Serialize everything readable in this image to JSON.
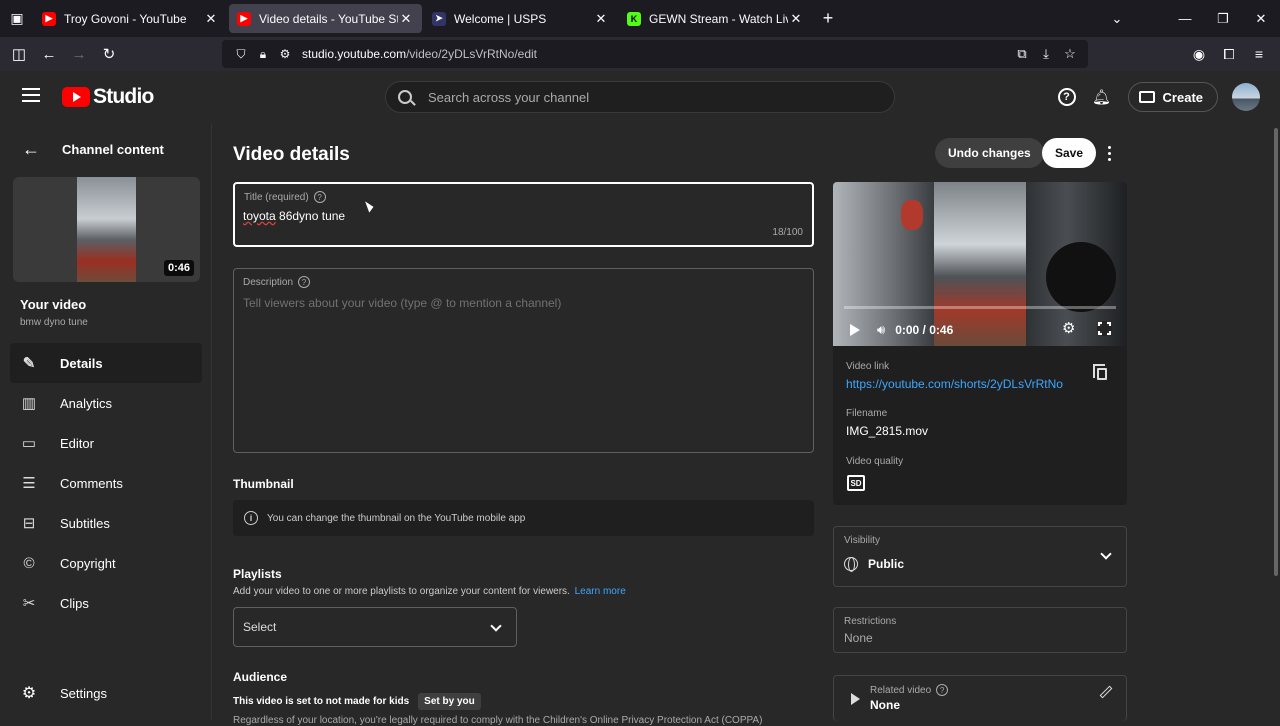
{
  "browser": {
    "tabs": [
      {
        "title": "Troy Govoni - YouTube",
        "favicon_color": "#ff0000",
        "favicon_glyph": "▶",
        "active": false
      },
      {
        "title": "Video details - YouTube Studio",
        "favicon_color": "#ff0000",
        "favicon_glyph": "▶",
        "active": true
      },
      {
        "title": "Welcome | USPS",
        "favicon_color": "#333366",
        "favicon_glyph": "➤",
        "active": false
      },
      {
        "title": "GEWN Stream - Watch Live on Kick",
        "favicon_color": "#53fc18",
        "favicon_glyph": "K",
        "active": false
      }
    ],
    "url_domain": "studio.youtube.com",
    "url_path": "/video/2yDLsVrRtNo/edit"
  },
  "header": {
    "logo_text": "Studio",
    "search_placeholder": "Search across your channel",
    "create_label": "Create"
  },
  "sidebar": {
    "back_label": "Channel content",
    "thumb_duration": "0:46",
    "your_video_label": "Your video",
    "video_subtitle": "bmw dyno tune",
    "items": [
      {
        "label": "Details",
        "icon": "✎",
        "icon_name": "pencil-icon",
        "active": true
      },
      {
        "label": "Analytics",
        "icon": "▥",
        "icon_name": "analytics-icon",
        "active": false
      },
      {
        "label": "Editor",
        "icon": "▭",
        "icon_name": "editor-icon",
        "active": false
      },
      {
        "label": "Comments",
        "icon": "☰",
        "icon_name": "comments-icon",
        "active": false
      },
      {
        "label": "Subtitles",
        "icon": "⊟",
        "icon_name": "subtitles-icon",
        "active": false
      },
      {
        "label": "Copyright",
        "icon": "©",
        "icon_name": "copyright-icon",
        "active": false
      },
      {
        "label": "Clips",
        "icon": "✂",
        "icon_name": "clips-icon",
        "active": false
      }
    ],
    "settings_label": "Settings"
  },
  "main": {
    "page_title": "Video details",
    "undo_label": "Undo changes",
    "save_label": "Save",
    "title_field": {
      "label": "Title (required)",
      "value_part1": "toyota",
      "value_part2": " 86dyno tune",
      "count": "18/100"
    },
    "description_field": {
      "label": "Description",
      "placeholder": "Tell viewers about your video (type @ to mention a channel)"
    },
    "thumbnail": {
      "title": "Thumbnail",
      "note": "You can change the thumbnail on the YouTube mobile app"
    },
    "playlists": {
      "title": "Playlists",
      "description": "Add your video to one or more playlists to organize your content for viewers.",
      "learn_more": "Learn more",
      "select_value": "Select"
    },
    "audience": {
      "title": "Audience",
      "status": "This video is set to not made for kids",
      "badge": "Set by you",
      "cut_text": "Regardless of your location, you're legally required to comply with the Children's Online Privacy Protection Act (COPPA)"
    }
  },
  "panel": {
    "player_time": "0:00 / 0:46",
    "video_link_label": "Video link",
    "video_link": "https://youtube.com/shorts/2yDLsVrRtNo",
    "filename_label": "Filename",
    "filename": "IMG_2815.mov",
    "quality_label": "Video quality",
    "quality_badge": "SD",
    "visibility_label": "Visibility",
    "visibility_value": "Public",
    "restrictions_label": "Restrictions",
    "restrictions_value": "None",
    "related_label": "Related video",
    "related_value": "None"
  }
}
